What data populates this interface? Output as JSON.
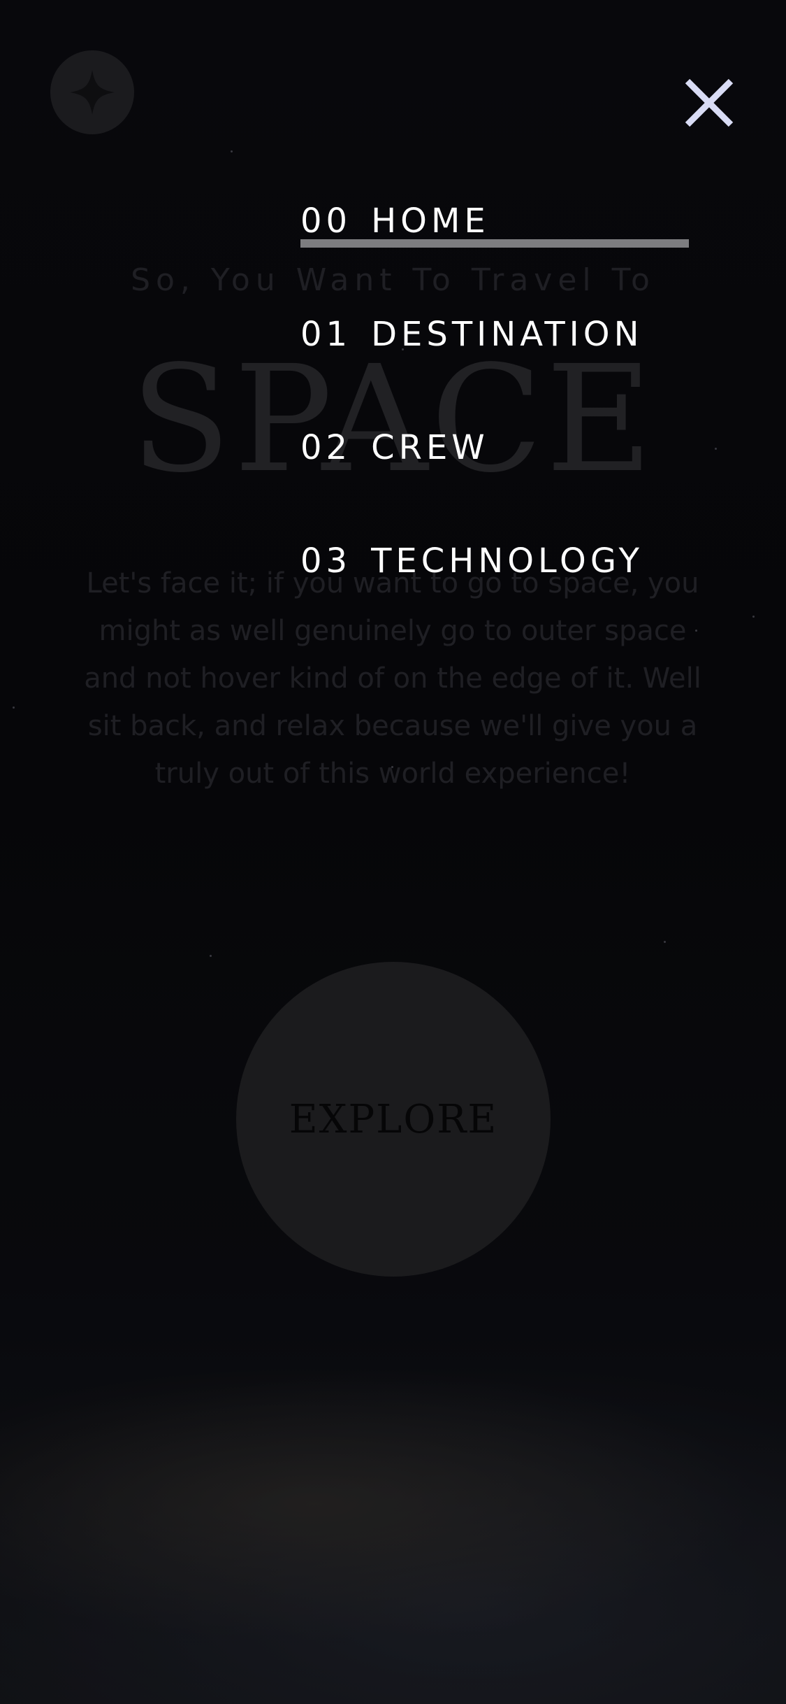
{
  "logo": {
    "icon": "star-logo-icon"
  },
  "close": {
    "icon": "close-icon",
    "color": "#d9dcf5"
  },
  "hero": {
    "eyebrow": "So, You Want To Travel To",
    "title": "SPACE",
    "body": "Let's face it; if you want to go to space, you might as well genuinely go to outer space and not hover kind of on the edge of it. Well sit back, and relax because we'll give you a truly out of this world experience!",
    "button": "EXPLORE"
  },
  "nav": {
    "items": [
      {
        "number": "00",
        "label": "HOME",
        "active": true
      },
      {
        "number": "01",
        "label": "DESTINATION",
        "active": false
      },
      {
        "number": "02",
        "label": "CREW",
        "active": false
      },
      {
        "number": "03",
        "label": "TECHNOLOGY",
        "active": false
      }
    ],
    "active_indicator_color": "#7d7d80"
  }
}
